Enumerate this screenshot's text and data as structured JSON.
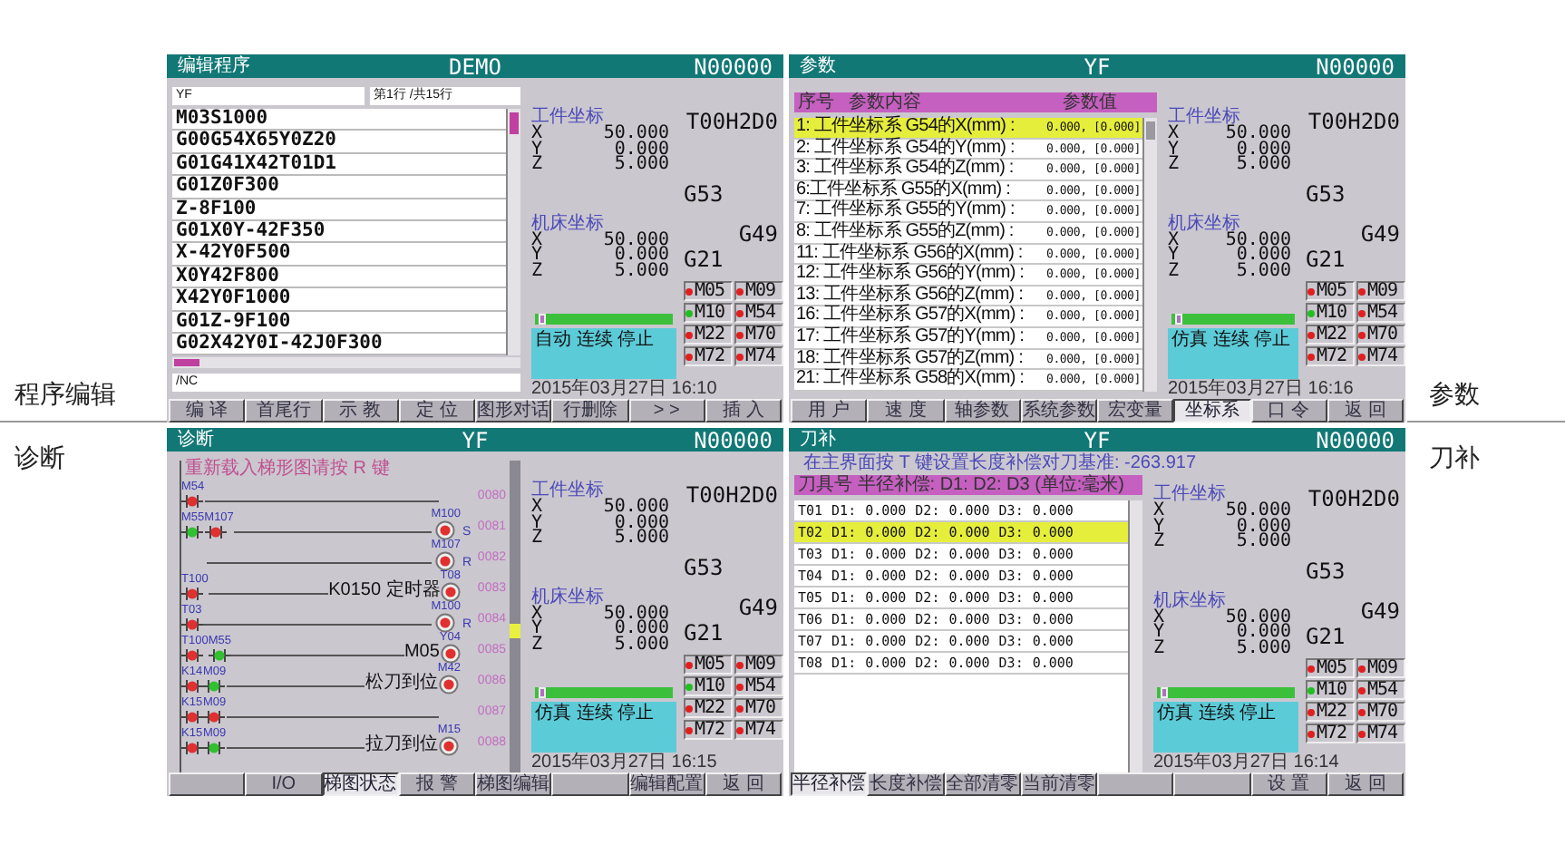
{
  "left_labels": [
    "程序编辑",
    "诊断"
  ],
  "right_labels": [
    "参数",
    "刀补"
  ],
  "panels": [
    {
      "kind": "program",
      "header": {
        "label": "编辑程序",
        "title": "DEMO",
        "number": "N00000"
      },
      "program": {
        "name_field": "YF",
        "line_info": "第1行 /共15行",
        "lines": [
          "M03S1000",
          "G00G54X65Y0Z20",
          "G01G41X42T01D1",
          "G01Z0F300",
          "Z-8F100",
          "G01X0Y-42F350",
          "X-42Y0F500",
          "X0Y42F800",
          "X42Y0F1000",
          "G01Z-9F100",
          "G02X42Y0I-42J0F300"
        ],
        "input_field": "/NC"
      },
      "status": {
        "tool": "T00H2D0",
        "work_label": "工件坐标",
        "work": [
          {
            "axis": "X",
            "value": "50.000"
          },
          {
            "axis": "Y",
            "value": "0.000"
          },
          {
            "axis": "Z",
            "value": "5.000"
          }
        ],
        "machine_label": "机床坐标",
        "machine": [
          {
            "axis": "X",
            "value": "50.000"
          },
          {
            "axis": "Y",
            "value": "0.000"
          },
          {
            "axis": "Z",
            "value": "5.000"
          }
        ],
        "codes": [
          "G53",
          "G49",
          "G21"
        ],
        "mcodes": [
          {
            "label": "M05",
            "color": "#e02020"
          },
          {
            "label": "M09",
            "color": "#e02020"
          },
          {
            "label": "M10",
            "color": "#20c020"
          },
          {
            "label": "M54",
            "color": "#e02020"
          },
          {
            "label": "M22",
            "color": "#e02020"
          },
          {
            "label": "M70",
            "color": "#e02020"
          },
          {
            "label": "M72",
            "color": "#e02020"
          },
          {
            "label": "M74",
            "color": "#e02020"
          }
        ],
        "progress": {
          "level": 0.03
        },
        "mode": "自动 连续 停止",
        "datetime": "2015年03月27日 16:10"
      },
      "softkeys": [
        {
          "label": "编 译",
          "selected": false
        },
        {
          "label": "首尾行",
          "selected": false
        },
        {
          "label": "示 教",
          "selected": false
        },
        {
          "label": "定 位",
          "selected": false
        },
        {
          "label": "图形对话",
          "selected": false
        },
        {
          "label": "行删除",
          "selected": false
        },
        {
          "label": "> >",
          "selected": false
        },
        {
          "label": "插 入",
          "selected": false
        }
      ]
    },
    {
      "kind": "params",
      "header": {
        "label": "参数",
        "title": "YF",
        "number": "N00000"
      },
      "table": {
        "columns": [
          "序号",
          "参数内容",
          "参数值"
        ],
        "rows": [
          {
            "label": "1: 工件坐标系 G54的X(mm) :",
            "value": "0.000, [0.000]",
            "selected": true
          },
          {
            "label": "2: 工件坐标系 G54的Y(mm) :",
            "value": "0.000, [0.000]",
            "selected": false
          },
          {
            "label": "3: 工件坐标系 G54的Z(mm) :",
            "value": "0.000, [0.000]",
            "selected": false
          },
          {
            "label": "6:工件坐标系 G55的X(mm) :",
            "value": "0.000, [0.000]",
            "selected": false
          },
          {
            "label": "7: 工件坐标系 G55的Y(mm) :",
            "value": "0.000, [0.000]",
            "selected": false
          },
          {
            "label": "8: 工件坐标系 G55的Z(mm) :",
            "value": "0.000, [0.000]",
            "selected": false
          },
          {
            "label": "11: 工件坐标系 G56的X(mm) :",
            "value": "0.000, [0.000]",
            "selected": false
          },
          {
            "label": "12: 工件坐标系 G56的Y(mm) :",
            "value": "0.000, [0.000]",
            "selected": false
          },
          {
            "label": "13: 工件坐标系 G56的Z(mm) :",
            "value": "0.000, [0.000]",
            "selected": false
          },
          {
            "label": "16: 工件坐标系 G57的X(mm) :",
            "value": "0.000, [0.000]",
            "selected": false
          },
          {
            "label": "17: 工件坐标系 G57的Y(mm) :",
            "value": "0.000, [0.000]",
            "selected": false
          },
          {
            "label": "18: 工件坐标系 G57的Z(mm) :",
            "value": "0.000, [0.000]",
            "selected": false
          },
          {
            "label": "21: 工件坐标系 G58的X(mm) :",
            "value": "0.000, [0.000]",
            "selected": false
          }
        ]
      },
      "status": {
        "tool": "T00H2D0",
        "work_label": "工件坐标",
        "work": [
          {
            "axis": "X",
            "value": "50.000"
          },
          {
            "axis": "Y",
            "value": "0.000"
          },
          {
            "axis": "Z",
            "value": "5.000"
          }
        ],
        "machine_label": "机床坐标",
        "machine": [
          {
            "axis": "X",
            "value": "50.000"
          },
          {
            "axis": "Y",
            "value": "0.000"
          },
          {
            "axis": "Z",
            "value": "5.000"
          }
        ],
        "codes": [
          "G53",
          "G49",
          "G21"
        ],
        "mcodes": [
          {
            "label": "M05",
            "color": "#e02020"
          },
          {
            "label": "M09",
            "color": "#e02020"
          },
          {
            "label": "M10",
            "color": "#20c020"
          },
          {
            "label": "M54",
            "color": "#e02020"
          },
          {
            "label": "M22",
            "color": "#e02020"
          },
          {
            "label": "M70",
            "color": "#e02020"
          },
          {
            "label": "M72",
            "color": "#e02020"
          },
          {
            "label": "M74",
            "color": "#e02020"
          }
        ],
        "progress": {
          "level": 0.03
        },
        "mode": "仿真 连续 停止",
        "datetime": "2015年03月27日 16:16"
      },
      "softkeys": [
        {
          "label": "用 户",
          "selected": false
        },
        {
          "label": "速 度",
          "selected": false
        },
        {
          "label": "轴参数",
          "selected": false
        },
        {
          "label": "系统参数",
          "selected": false
        },
        {
          "label": "宏变量",
          "selected": false
        },
        {
          "label": "坐标系",
          "selected": true
        },
        {
          "label": "口 令",
          "selected": false
        },
        {
          "label": "返 回",
          "selected": false
        }
      ]
    },
    {
      "kind": "ladder",
      "header": {
        "label": "诊断",
        "title": "YF",
        "number": "N00000"
      },
      "ladder": {
        "hint": "重新载入梯形图请按 R 键",
        "rungs": [
          {
            "contacts": [
              {
                "label": "M54",
                "color": "#e03030"
              }
            ],
            "number": "0080"
          },
          {
            "contacts": [
              {
                "label": "M55",
                "color": "#30c030"
              },
              {
                "label": "M107",
                "color": "#e03030"
              }
            ],
            "coil": {
              "label": "M100",
              "tag": "S"
            },
            "number": "0081"
          },
          {
            "coil": {
              "label": "M107",
              "tag": "R"
            },
            "number": "0082"
          },
          {
            "contacts": [
              {
                "label": "T100",
                "color": "#e03030"
              }
            ],
            "coil": {
              "label": "T08",
              "note": "K0150 定时器"
            },
            "number": "0083"
          },
          {
            "contacts": [
              {
                "label": "T03",
                "color": "#e03030"
              }
            ],
            "coil": {
              "label": "M100",
              "tag": "R"
            },
            "number": "0084"
          },
          {
            "contacts": [
              {
                "label": "T100",
                "color": "#e03030"
              },
              {
                "label": "M55",
                "color": "#30c030"
              }
            ],
            "coil": {
              "label": "Y04",
              "note": "M05"
            },
            "number": "0085"
          },
          {
            "contacts": [
              {
                "label": "K14",
                "color": "#e03030"
              },
              {
                "label": "M09",
                "color": "#30c030"
              }
            ],
            "coil": {
              "label": "M42",
              "note": "松刀到位"
            },
            "number": "0086"
          },
          {
            "contacts": [
              {
                "label": "K15",
                "color": "#e03030"
              },
              {
                "label": "M09",
                "color": "#e03030"
              }
            ],
            "number": "0087"
          },
          {
            "contacts": [
              {
                "label": "K15",
                "color": "#e03030"
              },
              {
                "label": "M09",
                "color": "#30c030"
              }
            ],
            "coil": {
              "label": "M15",
              "note": "拉刀到位"
            },
            "number": "0088"
          }
        ]
      },
      "status": {
        "tool": "T00H2D0",
        "work_label": "工件坐标",
        "work": [
          {
            "axis": "X",
            "value": "50.000"
          },
          {
            "axis": "Y",
            "value": "0.000"
          },
          {
            "axis": "Z",
            "value": "5.000"
          }
        ],
        "machine_label": "机床坐标",
        "machine": [
          {
            "axis": "X",
            "value": "50.000"
          },
          {
            "axis": "Y",
            "value": "0.000"
          },
          {
            "axis": "Z",
            "value": "5.000"
          }
        ],
        "codes": [
          "G53",
          "G49",
          "G21"
        ],
        "mcodes": [
          {
            "label": "M05",
            "color": "#e02020"
          },
          {
            "label": "M09",
            "color": "#e02020"
          },
          {
            "label": "M10",
            "color": "#20c020"
          },
          {
            "label": "M54",
            "color": "#e02020"
          },
          {
            "label": "M22",
            "color": "#e02020"
          },
          {
            "label": "M70",
            "color": "#e02020"
          },
          {
            "label": "M72",
            "color": "#e02020"
          },
          {
            "label": "M74",
            "color": "#e02020"
          }
        ],
        "progress": {
          "level": 0.03
        },
        "mode": "仿真 连续 停止",
        "datetime": "2015年03月27日 16:15"
      },
      "softkeys": [
        {
          "selected": false
        },
        {
          "label": "I/O",
          "selected": false
        },
        {
          "label": "梯图状态",
          "selected": true
        },
        {
          "label": "报 警",
          "selected": false
        },
        {
          "label": "梯图编辑",
          "selected": false
        },
        {
          "selected": false
        },
        {
          "label": "编辑配置",
          "selected": false
        },
        {
          "label": "返 回",
          "selected": false
        }
      ]
    },
    {
      "kind": "tools",
      "header": {
        "label": "刀补",
        "title": "YF",
        "number": "N00000"
      },
      "tools": {
        "note": "在主界面按 T 键设置长度补偿对刀基准:  -263.917",
        "heading": "刀具号  半径补偿: D1: D2: D3  (单位:毫米)",
        "rows": [
          {
            "tool": "T01",
            "offsets": [
              {
                "label": "D1:",
                "value": "0.000"
              },
              {
                "label": "D2:",
                "value": "0.000"
              },
              {
                "label": "D3:",
                "value": "0.000"
              }
            ],
            "selected": false
          },
          {
            "tool": "T02",
            "offsets": [
              {
                "label": "D1:",
                "value": "0.000"
              },
              {
                "label": "D2:",
                "value": "0.000"
              },
              {
                "label": "D3:",
                "value": "0.000"
              }
            ],
            "selected": true
          },
          {
            "tool": "T03",
            "offsets": [
              {
                "label": "D1:",
                "value": "0.000"
              },
              {
                "label": "D2:",
                "value": "0.000"
              },
              {
                "label": "D3:",
                "value": "0.000"
              }
            ],
            "selected": false
          },
          {
            "tool": "T04",
            "offsets": [
              {
                "label": "D1:",
                "value": "0.000"
              },
              {
                "label": "D2:",
                "value": "0.000"
              },
              {
                "label": "D3:",
                "value": "0.000"
              }
            ],
            "selected": false
          },
          {
            "tool": "T05",
            "offsets": [
              {
                "label": "D1:",
                "value": "0.000"
              },
              {
                "label": "D2:",
                "value": "0.000"
              },
              {
                "label": "D3:",
                "value": "0.000"
              }
            ],
            "selected": false
          },
          {
            "tool": "T06",
            "offsets": [
              {
                "label": "D1:",
                "value": "0.000"
              },
              {
                "label": "D2:",
                "value": "0.000"
              },
              {
                "label": "D3:",
                "value": "0.000"
              }
            ],
            "selected": false
          },
          {
            "tool": "T07",
            "offsets": [
              {
                "label": "D1:",
                "value": "0.000"
              },
              {
                "label": "D2:",
                "value": "0.000"
              },
              {
                "label": "D3:",
                "value": "0.000"
              }
            ],
            "selected": false
          },
          {
            "tool": "T08",
            "offsets": [
              {
                "label": "D1:",
                "value": "0.000"
              },
              {
                "label": "D2:",
                "value": "0.000"
              },
              {
                "label": "D3:",
                "value": "0.000"
              }
            ],
            "selected": false
          }
        ]
      },
      "status": {
        "tool": "T00H2D0",
        "work_label": "工件坐标",
        "work": [
          {
            "axis": "X",
            "value": "50.000"
          },
          {
            "axis": "Y",
            "value": "0.000"
          },
          {
            "axis": "Z",
            "value": "5.000"
          }
        ],
        "machine_label": "机床坐标",
        "machine": [
          {
            "axis": "X",
            "value": "50.000"
          },
          {
            "axis": "Y",
            "value": "0.000"
          },
          {
            "axis": "Z",
            "value": "5.000"
          }
        ],
        "codes": [
          "G53",
          "G49",
          "G21"
        ],
        "mcodes": [
          {
            "label": "M05",
            "color": "#e02020"
          },
          {
            "label": "M09",
            "color": "#e02020"
          },
          {
            "label": "M10",
            "color": "#20c020"
          },
          {
            "label": "M54",
            "color": "#e02020"
          },
          {
            "label": "M22",
            "color": "#e02020"
          },
          {
            "label": "M70",
            "color": "#e02020"
          },
          {
            "label": "M72",
            "color": "#e02020"
          },
          {
            "label": "M74",
            "color": "#e02020"
          }
        ],
        "progress": {
          "level": 0.03
        },
        "mode": "仿真 连续 停止",
        "datetime": "2015年03月27日 16:14"
      },
      "softkeys": [
        {
          "label": "半径补偿",
          "selected": true
        },
        {
          "label": "长度补偿",
          "selected": false
        },
        {
          "label": "全部清零",
          "selected": false
        },
        {
          "label": "当前清零",
          "selected": false
        },
        {
          "selected": false
        },
        {
          "selected": false
        },
        {
          "label": "设 置",
          "selected": false
        },
        {
          "label": "返 回",
          "selected": false
        }
      ]
    }
  ]
}
